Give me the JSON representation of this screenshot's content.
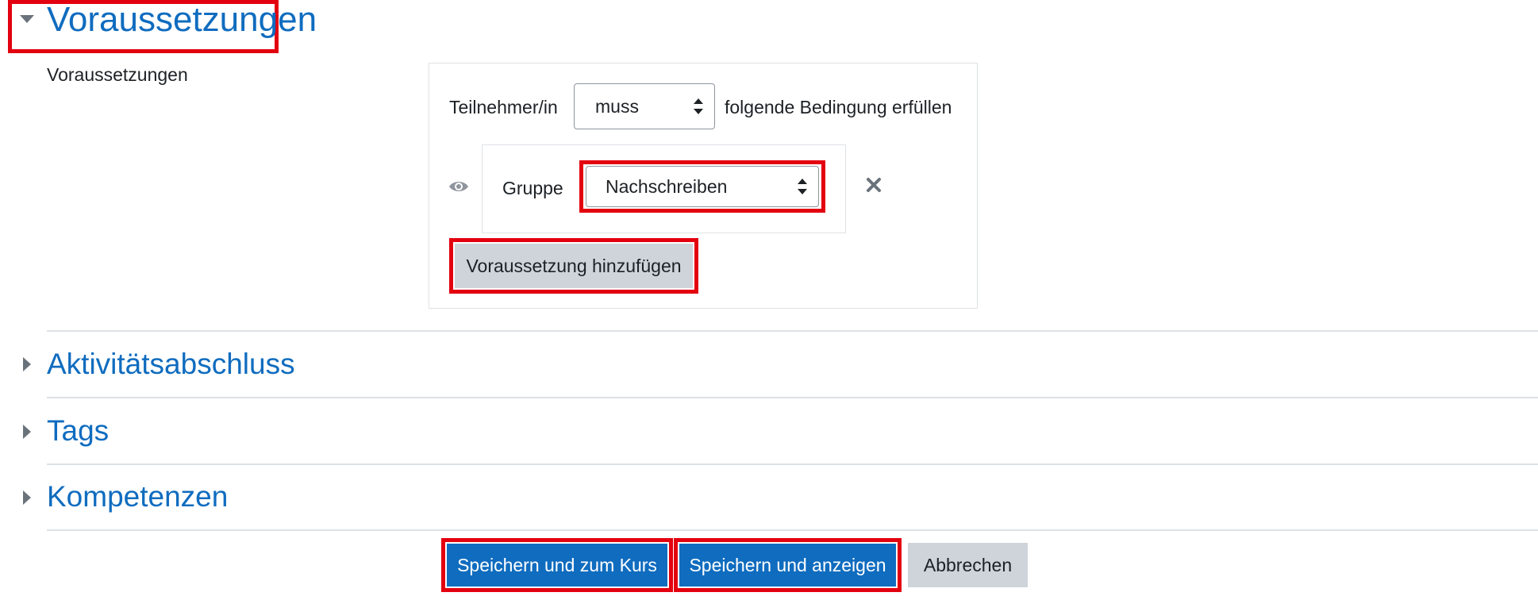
{
  "sections": {
    "voraussetzungen": "Voraussetzungen",
    "aktivitaetsabschluss": "Aktivitätsabschluss",
    "tags": "Tags",
    "kompetenzen": "Kompetenzen"
  },
  "restrictions": {
    "field_label": "Voraussetzungen",
    "prefix": "Teilnehmer/in",
    "must_select": "muss",
    "suffix": "folgende Bedingung erfüllen",
    "condition_type": "Gruppe",
    "group_select": "Nachschreiben",
    "add_button": "Voraussetzung hinzufügen"
  },
  "buttons": {
    "save_return": "Speichern und zum Kurs",
    "save_display": "Speichern und anzeigen",
    "cancel": "Abbrechen"
  },
  "colors": {
    "link_blue": "#0f6cbf",
    "highlight_red": "#e3000f",
    "primary_button": "#0f6cbf",
    "secondary_button": "#ced4da"
  }
}
